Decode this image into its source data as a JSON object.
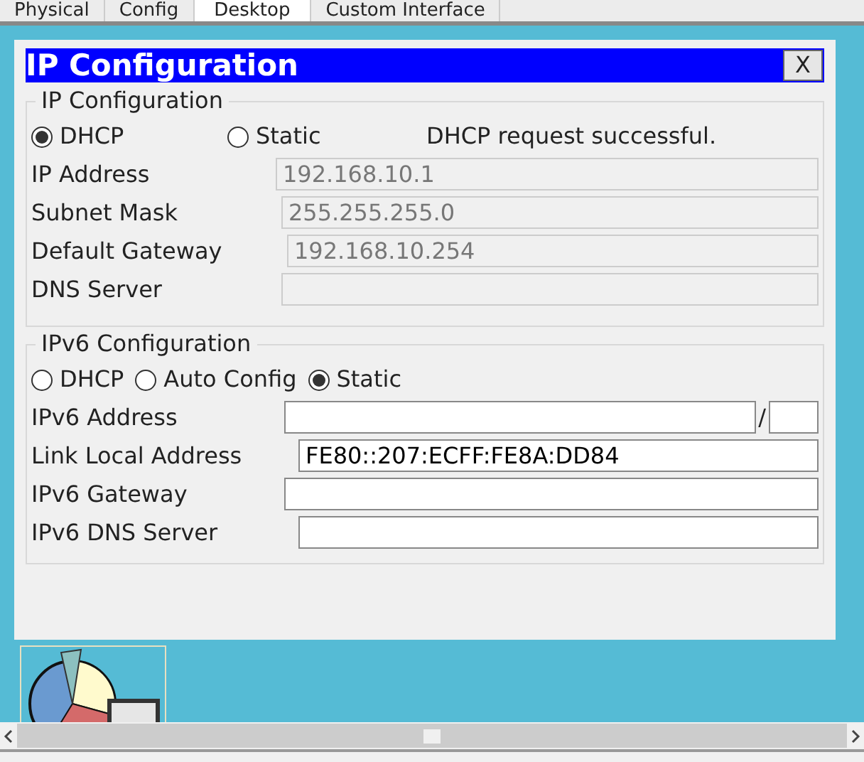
{
  "tabs": [
    {
      "label": "Physical",
      "selected": false
    },
    {
      "label": "Config",
      "selected": false
    },
    {
      "label": "Desktop",
      "selected": true
    },
    {
      "label": "Custom Interface",
      "selected": false
    }
  ],
  "dialog": {
    "title": "IP Configuration",
    "close": "X"
  },
  "ipv4": {
    "legend": "IP Configuration",
    "modes": [
      {
        "label": "DHCP",
        "selected": true
      },
      {
        "label": "Static",
        "selected": false
      }
    ],
    "status": "DHCP request successful.",
    "fields": [
      {
        "label": "IP Address",
        "value": "192.168.10.1",
        "disabled": true
      },
      {
        "label": "Subnet Mask",
        "value": "255.255.255.0",
        "disabled": true
      },
      {
        "label": "Default Gateway",
        "value": "192.168.10.254",
        "disabled": true
      },
      {
        "label": "DNS Server",
        "disabled": true
      }
    ]
  },
  "ipv6": {
    "legend": "IPv6 Configuration",
    "modes": [
      {
        "label": "DHCP",
        "selected": false
      },
      {
        "label": "Auto Config",
        "selected": false
      },
      {
        "label": "Static",
        "selected": true
      }
    ],
    "fields": [
      {
        "label": "IPv6 Address",
        "kind": "prefix",
        "separator": "/"
      },
      {
        "label": "Link Local Address",
        "value": "FE80::207:ECFF:FE8A:DD84",
        "kind": "plain"
      },
      {
        "label": "IPv6 Gateway",
        "kind": "plain"
      },
      {
        "label": "IPv6 DNS Server",
        "kind": "plain"
      }
    ]
  }
}
